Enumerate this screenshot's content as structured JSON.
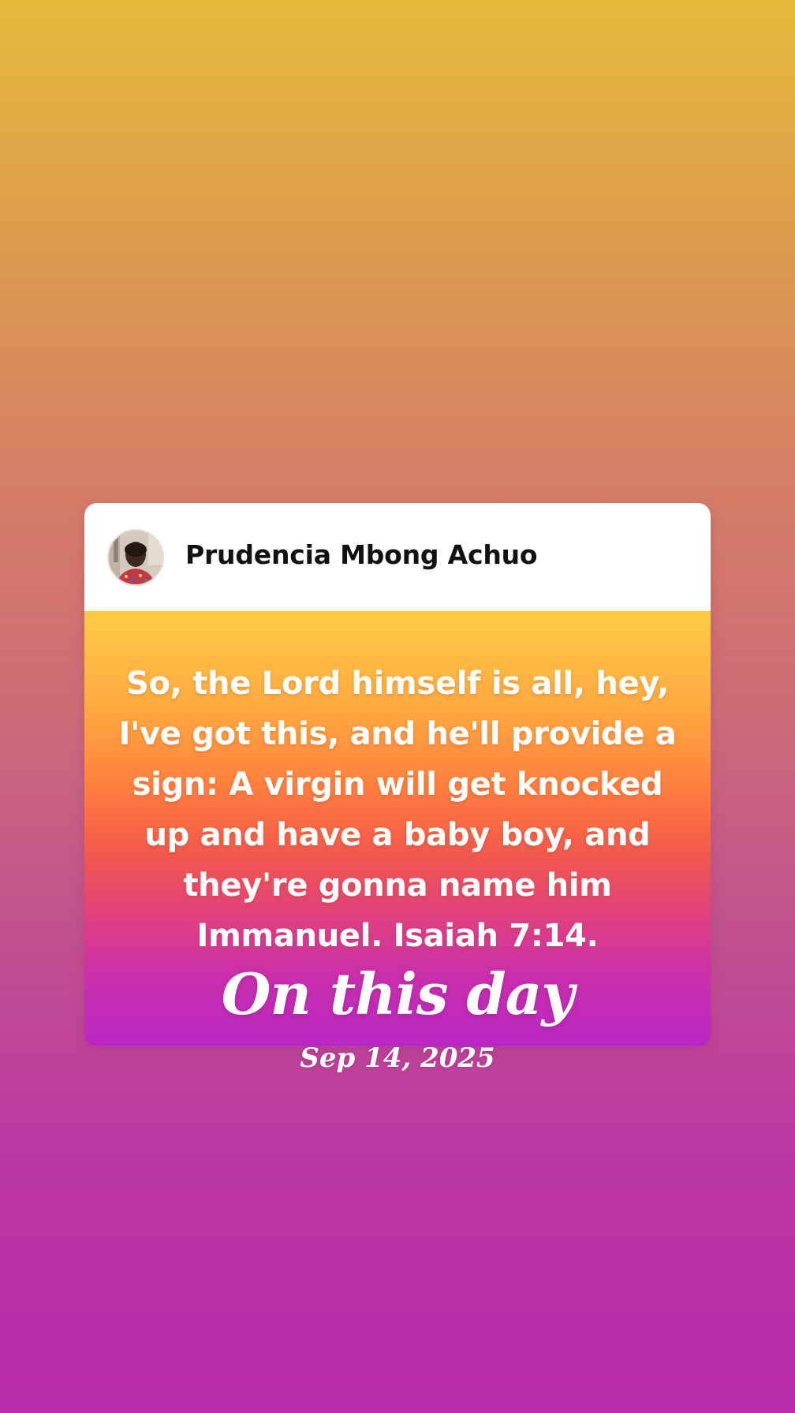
{
  "post": {
    "author_name": "Prudencia Mbong Achuo",
    "avatar": "profile-photo",
    "text": "So, the Lord himself is all, hey, I've got this, and he'll provide a sign: A virgin will get knocked up and have a baby boy, and they're gonna name him Immanuel. Isaiah 7:14."
  },
  "memory": {
    "title": "On this day",
    "date": "Sep 14, 2025"
  },
  "colors": {
    "background_top": "#E6B93C",
    "background_bottom": "#B92BAA",
    "card_body_top": "#FFCB46",
    "card_body_bottom": "#BA28C4"
  }
}
